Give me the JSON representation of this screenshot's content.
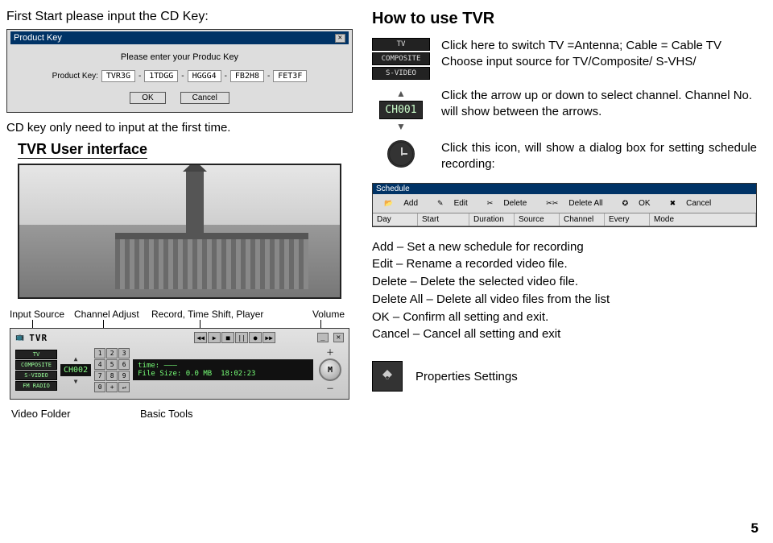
{
  "left": {
    "intro": "First Start please input the CD Key:",
    "dialog": {
      "title": "Product Key",
      "prompt": "Please enter your Produc Key",
      "label": "Product Key:",
      "segs": [
        "TVR3G",
        "1TDGG",
        "HGGG4",
        "FB2H8",
        "FET3F"
      ],
      "ok": "OK",
      "cancel": "Cancel"
    },
    "note": "CD key only need to input at the first time.",
    "tvr_heading": "TVR User interface",
    "player": {
      "brand": "TVR",
      "sources": [
        "TV",
        "COMPOSITE",
        "S-VIDEO",
        "FM RADIO"
      ],
      "ch": "CH002",
      "time_label": "time:",
      "file_label": "File Size:",
      "file_val": "0.0 MB",
      "clock": "18:02:23"
    },
    "labels": {
      "input_source": "Input Source",
      "channel_adjust": "Channel Adjust",
      "record": "Record, Time Shift, Player",
      "volume": "Volume",
      "video_folder": "Video Folder",
      "basic_tools": "Basic Tools"
    }
  },
  "right": {
    "title": "How to use TVR",
    "src_labels": [
      "TV",
      "COMPOSITE",
      "S-VIDEO"
    ],
    "src_text": "Click here to switch TV =Antenna; Cable = Cable TV\nChoose input source for TV/Composite/ S-VHS/",
    "ch_disp": "CH001",
    "ch_text": "Click the arrow up or down to select channel. Channel No. will show between the arrows.",
    "clock_text": "Click this icon, will show a dialog box for setting schedule recording:",
    "sched": {
      "title": "Schedule",
      "toolbar": [
        "Add",
        "Edit",
        "Delete",
        "Delete All",
        "OK",
        "Cancel"
      ],
      "cols": [
        "Day",
        "Start",
        "Duration",
        "Source",
        "Channel",
        "Every",
        "Mode"
      ]
    },
    "defs": [
      "Add – Set a new schedule for recording",
      "Edit – Rename a recorded video file.",
      "Delete – Delete the selected video file.",
      "Delete All – Delete all video files from the list",
      "OK – Confirm all setting and exit.",
      "Cancel – Cancel all setting and exit"
    ],
    "props": "Properties Settings"
  },
  "page_number": "5"
}
